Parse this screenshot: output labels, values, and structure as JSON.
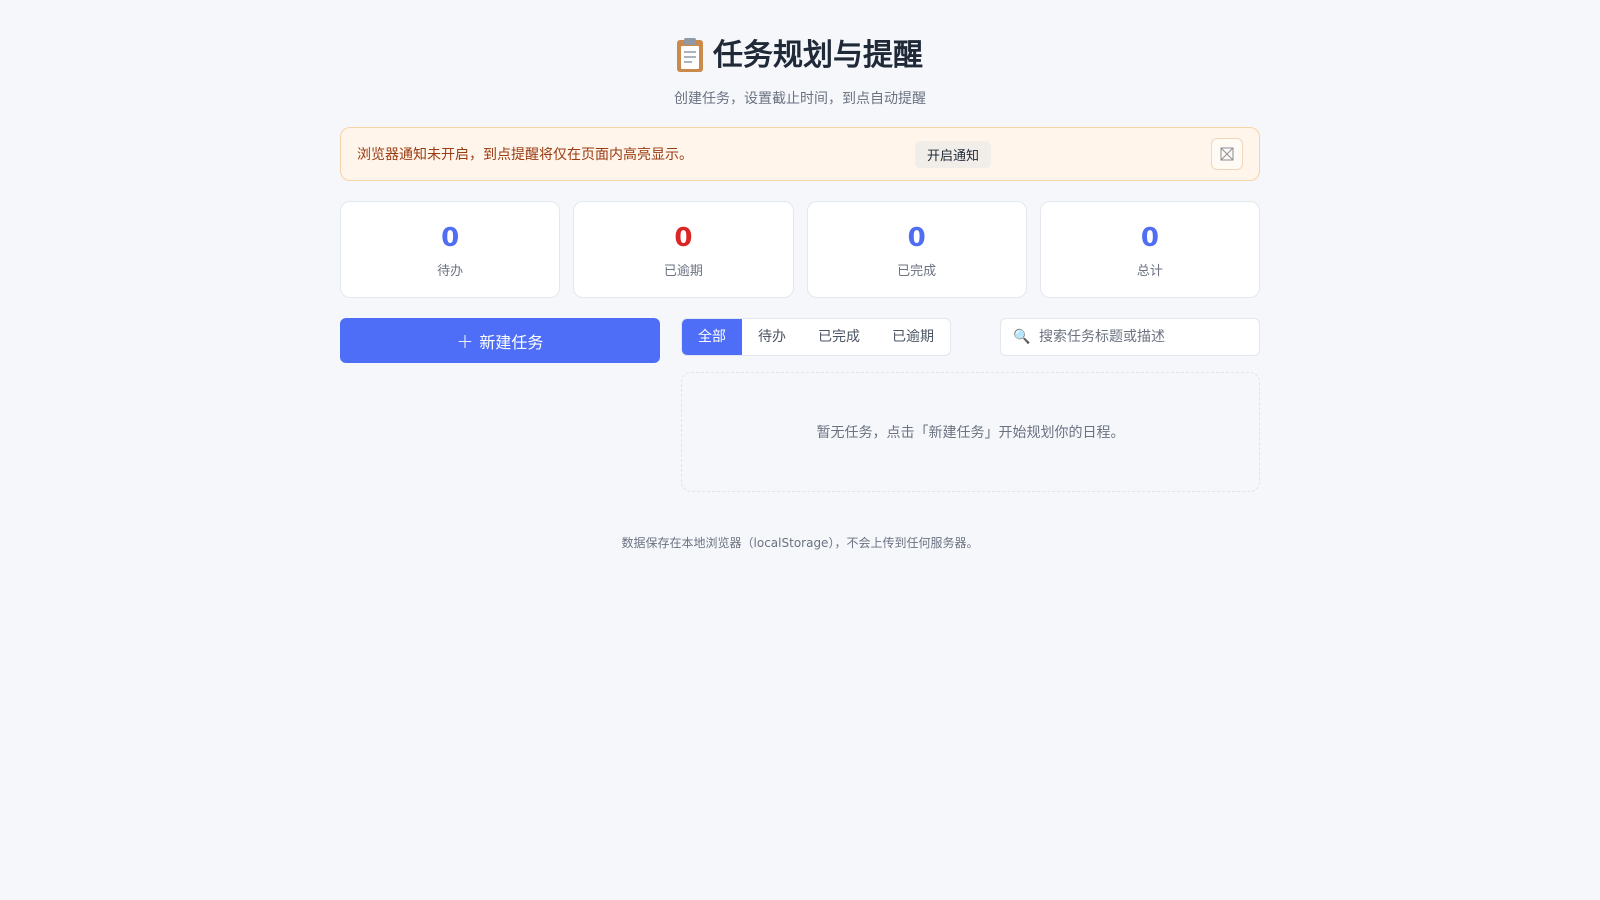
{
  "header": {
    "icon": "clipboard-icon",
    "title": "任务规划与提醒",
    "subtitle": "创建任务，设置截止时间，到点自动提醒"
  },
  "notice": {
    "text": "浏览器通知未开启，到点提醒将仅在页面内高亮显示。",
    "enable_label": "开启通知",
    "close_icon": "close-icon"
  },
  "stats": [
    {
      "value": "0",
      "label": "待办",
      "color": "#4f6ef2"
    },
    {
      "value": "0",
      "label": "已逾期",
      "color": "#dc2626"
    },
    {
      "value": "0",
      "label": "已完成",
      "color": "#4f6ef2"
    },
    {
      "value": "0",
      "label": "总计",
      "color": "#4f6ef2"
    }
  ],
  "toolbar": {
    "new_task_label": "新建任务",
    "tabs": [
      {
        "label": "全部",
        "active": true
      },
      {
        "label": "待办",
        "active": false
      },
      {
        "label": "已完成",
        "active": false
      },
      {
        "label": "已逾期",
        "active": false
      }
    ],
    "search_placeholder": "搜索任务标题或描述",
    "search_value": ""
  },
  "empty_state": {
    "text": "暂无任务，点击「新建任务」开始规划你的日程。"
  },
  "footer": {
    "text": "数据保存在本地浏览器（localStorage），不会上传到任何服务器。"
  },
  "colors": {
    "accent": "#4f6ef7",
    "danger": "#dc2626",
    "background": "#f5f7fb",
    "notice_bg": "#fff5eb"
  }
}
